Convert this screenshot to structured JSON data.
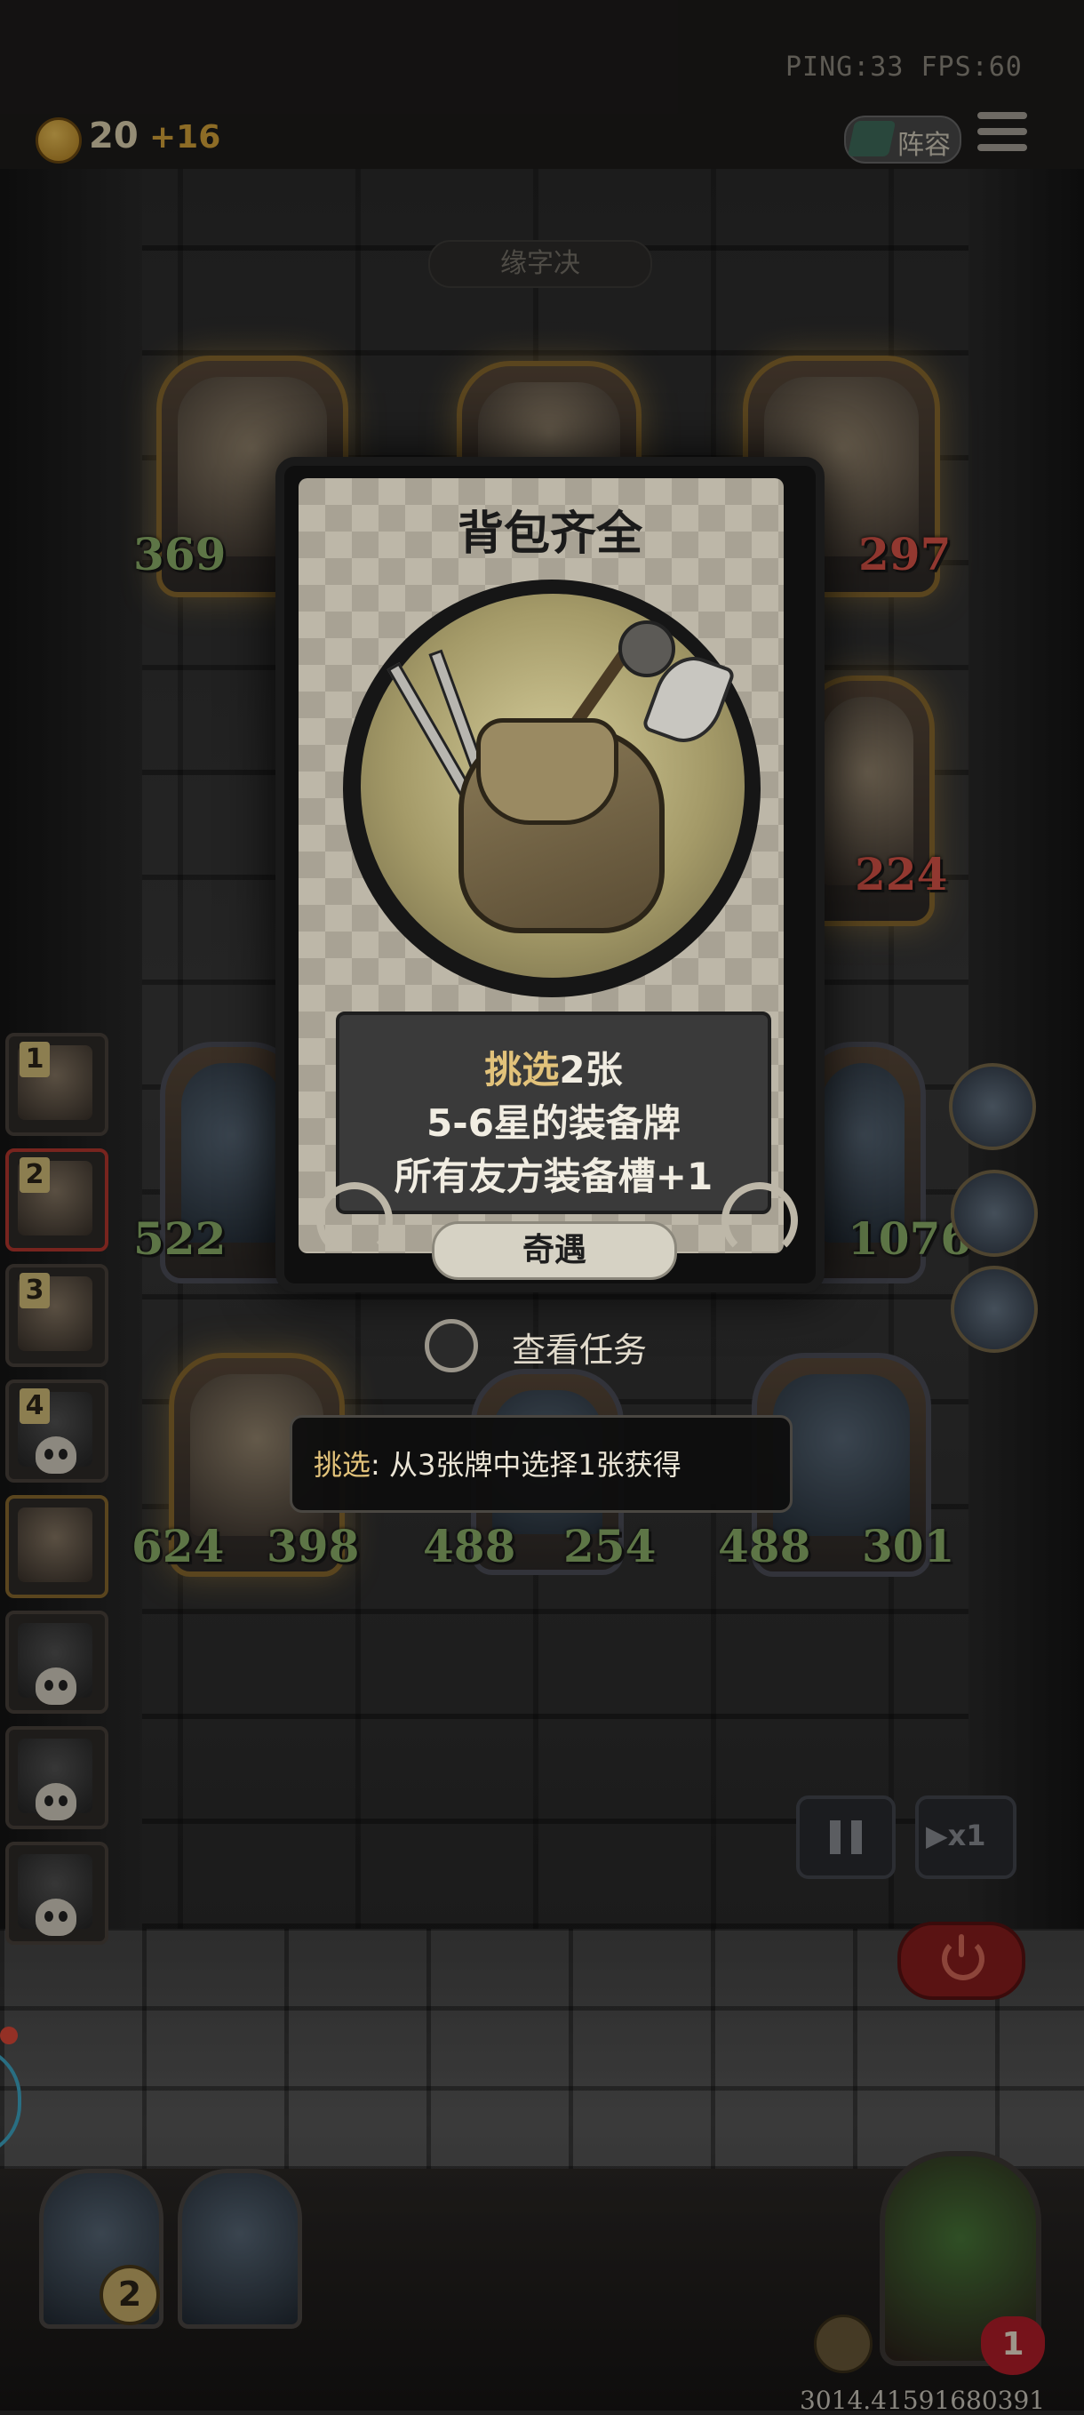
{
  "hud": {
    "coins": "20",
    "coin_income": "+16",
    "ping_fps": "PING:33   FPS:60",
    "roster_label": "阵容"
  },
  "board": {
    "banner": "缘字决",
    "heroes": [
      {
        "id": "top-left",
        "attack": "369",
        "health": null
      },
      {
        "id": "top-right",
        "attack": null,
        "health": "297"
      },
      {
        "id": "right-mid",
        "attack": null,
        "health": "224"
      },
      {
        "id": "mid-left",
        "attack": "522",
        "health": null
      },
      {
        "id": "mid-right",
        "attack": null,
        "health": "1076"
      },
      {
        "id": "bottom-1",
        "attack": "624",
        "health": "398"
      },
      {
        "id": "bottom-2",
        "attack": "488",
        "health": "254"
      },
      {
        "id": "bottom-3",
        "attack": "488",
        "health": "301"
      }
    ]
  },
  "queue": [
    {
      "number": "1",
      "state": "alive"
    },
    {
      "number": "2",
      "state": "selected"
    },
    {
      "number": "3",
      "state": "alive"
    },
    {
      "number": "4",
      "state": "dead"
    },
    {
      "number": "",
      "state": "current"
    },
    {
      "number": "",
      "state": "dead"
    },
    {
      "number": "",
      "state": "dead"
    },
    {
      "number": "",
      "state": "dead"
    }
  ],
  "event_card": {
    "title": "背包齐全",
    "desc_highlight": "挑选",
    "desc_line1_rest": "2张",
    "desc_line2": "5-6星的装备牌",
    "desc_line3": "所有友方装备槽+1",
    "tag": "奇遇",
    "icon": "backpack-with-weapons-icon"
  },
  "view_task_label": "查看任务",
  "tooltip": {
    "keyword": "挑选",
    "text": ": 从3张牌中选择1张获得"
  },
  "controls": {
    "speed_label": "▶x1"
  },
  "bottom": {
    "hand_badge": "2",
    "player_lives": "1",
    "seed": "3014.41591680391"
  },
  "colors": {
    "attack": "#8fb46c",
    "health": "#e0564a",
    "highlight": "#e2c27a",
    "gold_frame": "#8a6a2e"
  }
}
